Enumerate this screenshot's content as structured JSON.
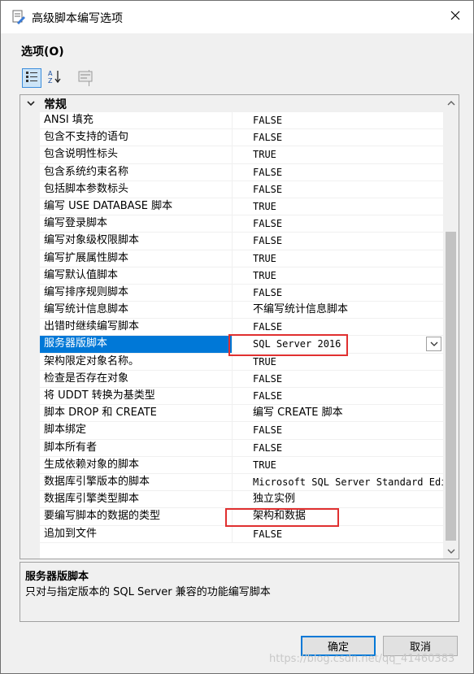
{
  "window": {
    "title": "高级脚本编写选项"
  },
  "options_label": "选项(O)",
  "category": {
    "label": "常规"
  },
  "rows": [
    {
      "name": "ANSI 填充",
      "value": "FALSE"
    },
    {
      "name": "包含不支持的语句",
      "value": "FALSE"
    },
    {
      "name": "包含说明性标头",
      "value": "TRUE"
    },
    {
      "name": "包含系统约束名称",
      "value": "FALSE"
    },
    {
      "name": "包括脚本参数标头",
      "value": "FALSE"
    },
    {
      "name": "编写 USE DATABASE 脚本",
      "value": "TRUE"
    },
    {
      "name": "编写登录脚本",
      "value": "FALSE"
    },
    {
      "name": "编写对象级权限脚本",
      "value": "FALSE"
    },
    {
      "name": "编写扩展属性脚本",
      "value": "TRUE"
    },
    {
      "name": "编写默认值脚本",
      "value": "TRUE"
    },
    {
      "name": "编写排序规则脚本",
      "value": "FALSE"
    },
    {
      "name": "编写统计信息脚本",
      "value": "不编写统计信息脚本"
    },
    {
      "name": "出错时继续编写脚本",
      "value": "FALSE"
    },
    {
      "name": "服务器版脚本",
      "value": "SQL Server 2016"
    },
    {
      "name": "架构限定对象名称。",
      "value": "TRUE"
    },
    {
      "name": "检查是否存在对象",
      "value": "FALSE"
    },
    {
      "name": "将 UDDT 转换为基类型",
      "value": "FALSE"
    },
    {
      "name": "脚本 DROP 和 CREATE",
      "value": "编写 CREATE 脚本"
    },
    {
      "name": "脚本绑定",
      "value": "FALSE"
    },
    {
      "name": "脚本所有者",
      "value": "FALSE"
    },
    {
      "name": "生成依赖对象的脚本",
      "value": "TRUE"
    },
    {
      "name": "数据库引擎版本的脚本",
      "value": "Microsoft SQL Server Standard Edit"
    },
    {
      "name": "数据库引擎类型脚本",
      "value": "独立实例"
    },
    {
      "name": "要编写脚本的数据的类型",
      "value": "架构和数据"
    },
    {
      "name": "追加到文件",
      "value": "FALSE"
    }
  ],
  "description": {
    "title": "服务器版脚本",
    "text": "只对与指定版本的 SQL Server 兼容的功能编写脚本"
  },
  "buttons": {
    "ok": "确定",
    "cancel": "取消"
  },
  "watermark": "https://blog.csdn.net/qq_41460383",
  "icons": {
    "app": "script-options-icon",
    "close": "close-icon",
    "categorized": "categorized-icon",
    "alphabetical": "alphabetical-sort-icon",
    "property_pages": "property-pages-icon"
  },
  "colors": {
    "selection": "#0078d7",
    "highlight": "#e03030"
  }
}
